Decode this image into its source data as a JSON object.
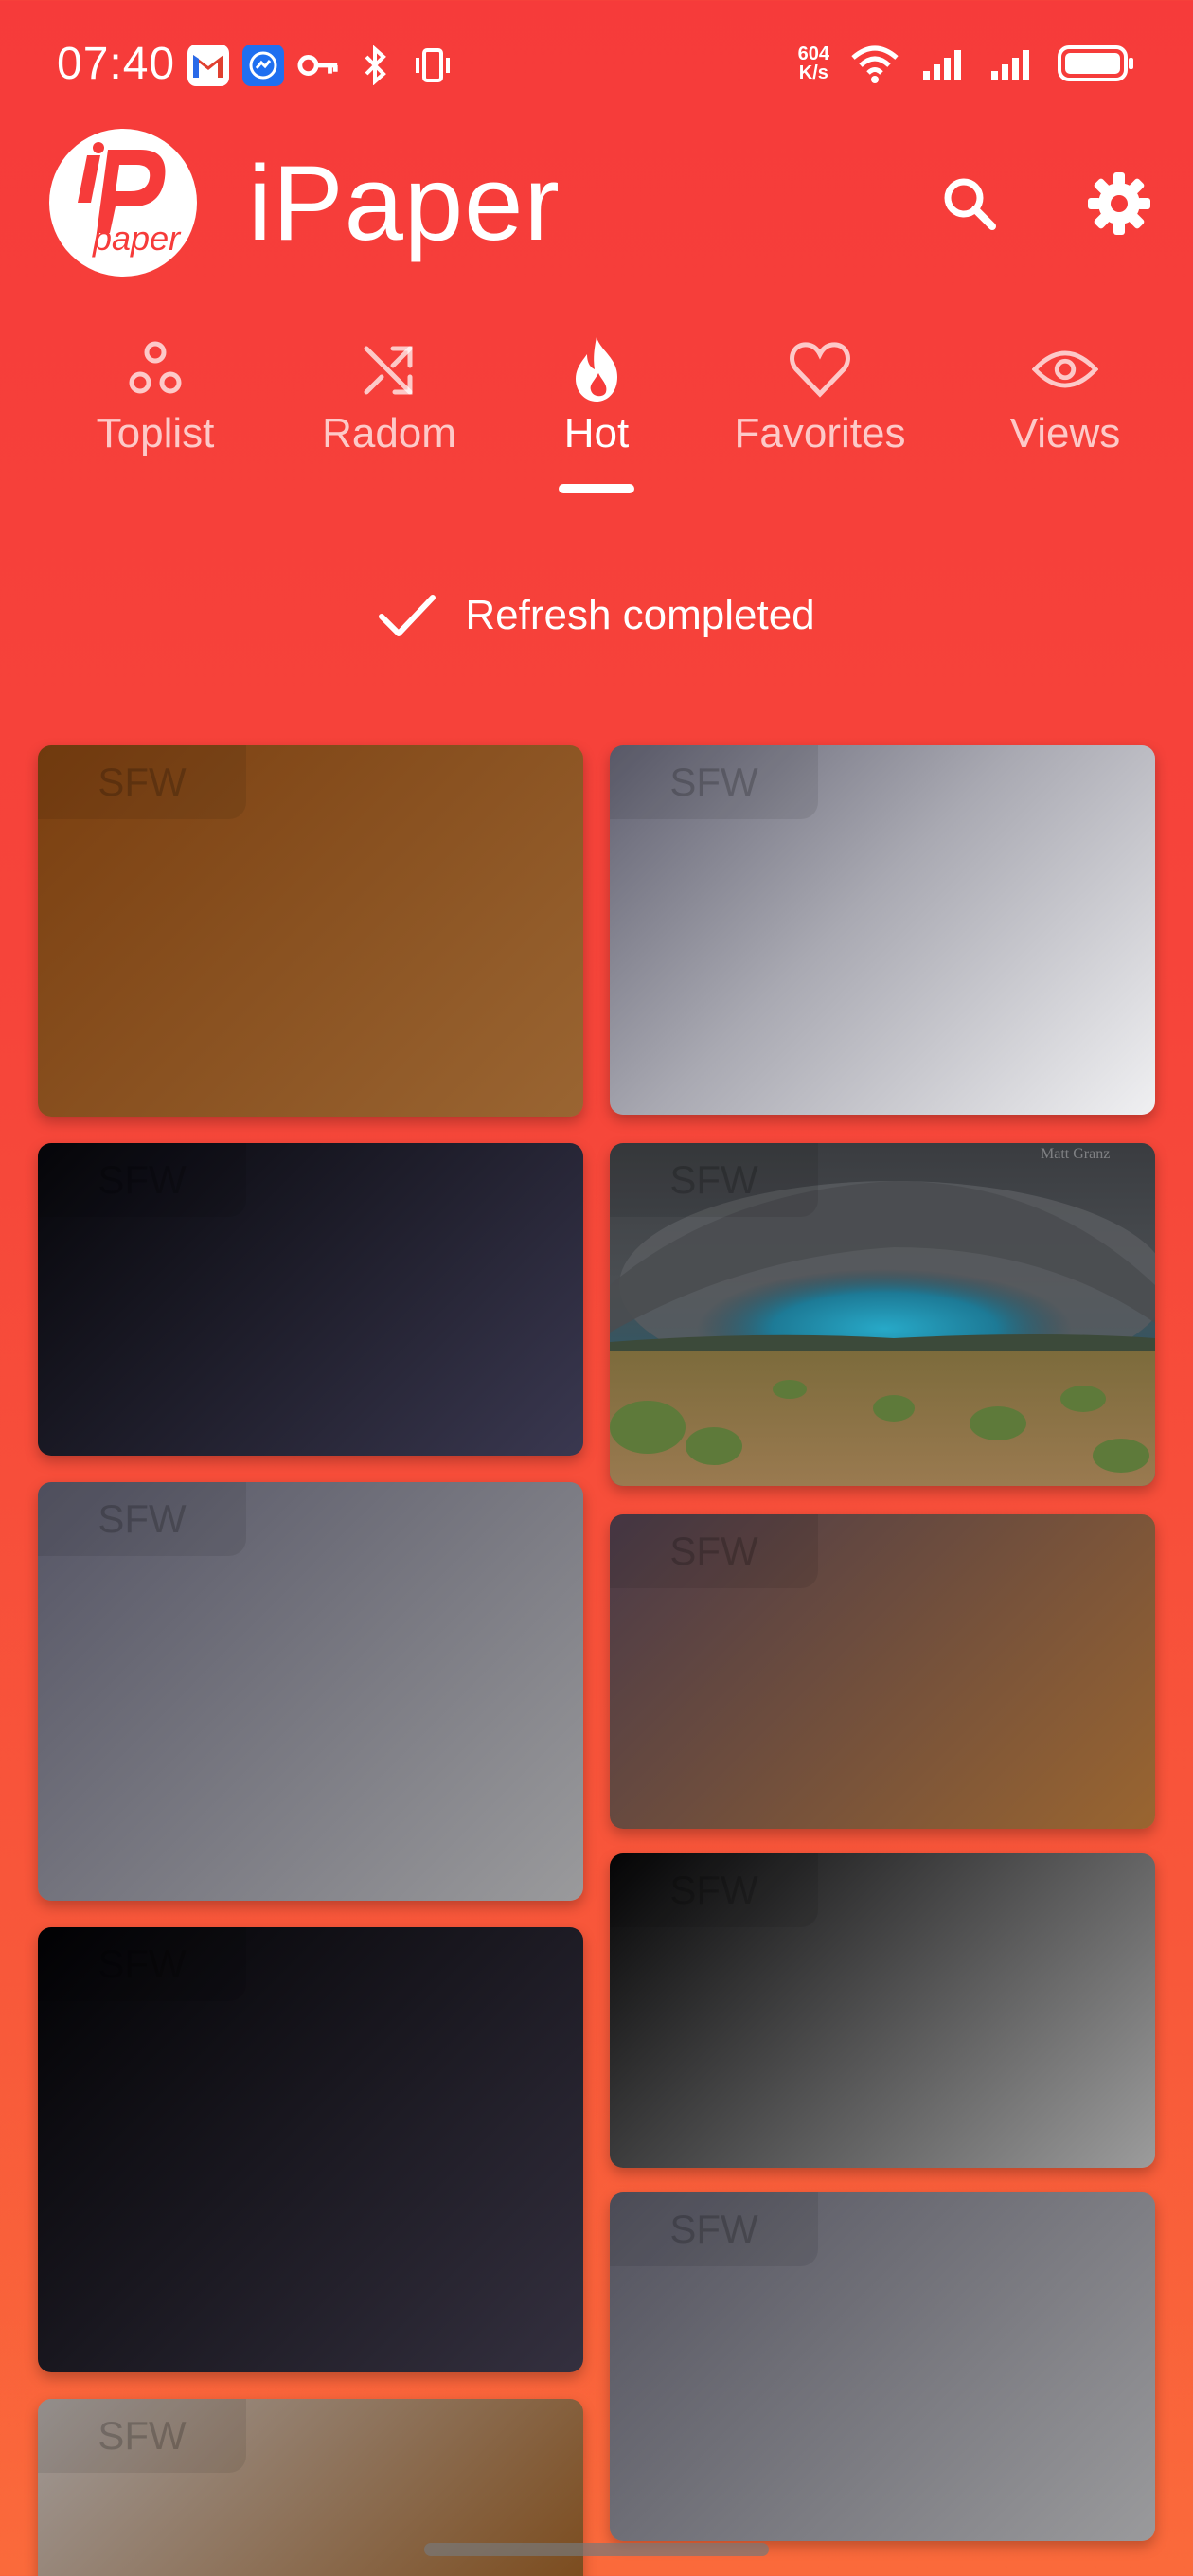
{
  "status": {
    "time": "07:40",
    "net_speed_value": "604",
    "net_speed_unit": "K/s",
    "battery": "battery-full"
  },
  "app": {
    "title": "iPaper",
    "logo_text": "paper"
  },
  "tabs": [
    {
      "label": "Toplist",
      "icon": "toplist-icon",
      "active": false
    },
    {
      "label": "Radom",
      "icon": "shuffle-icon",
      "active": false
    },
    {
      "label": "Hot",
      "icon": "flame-icon",
      "active": true
    },
    {
      "label": "Favorites",
      "icon": "heart-icon",
      "active": false
    },
    {
      "label": "Views",
      "icon": "eye-icon",
      "active": false
    }
  ],
  "refresh": {
    "text": "Refresh completed"
  },
  "wallpapers": [
    {
      "badge": "SFW",
      "colors": [
        "#7a3f10",
        "#9a6532"
      ]
    },
    {
      "badge": "SFW",
      "colors": [
        "#606070",
        "#f0f0f2"
      ]
    },
    {
      "badge": "SFW",
      "colors": [
        "#06060a",
        "#3a3850"
      ]
    },
    {
      "badge": "SFW",
      "image": "storm-landscape",
      "watermark": "Matt Granz"
    },
    {
      "badge": "SFW",
      "colors": [
        "#555565",
        "#9a9a9c"
      ]
    },
    {
      "badge": "SFW",
      "colors": [
        "#4a3a48",
        "#9a6530"
      ]
    },
    {
      "badge": "SFW",
      "colors": [
        "#020204",
        "#34303f"
      ]
    },
    {
      "badge": "SFW",
      "colors": [
        "#050506",
        "#9c9c9c"
      ]
    },
    {
      "badge": "SFW",
      "colors": [
        "#a09a98",
        "#7a4818"
      ]
    },
    {
      "badge": "SFW",
      "colors": [
        "#52525e",
        "#9a9a9c"
      ]
    }
  ],
  "colors": {
    "accent": "#f63b3a",
    "text": "#ffffff"
  }
}
